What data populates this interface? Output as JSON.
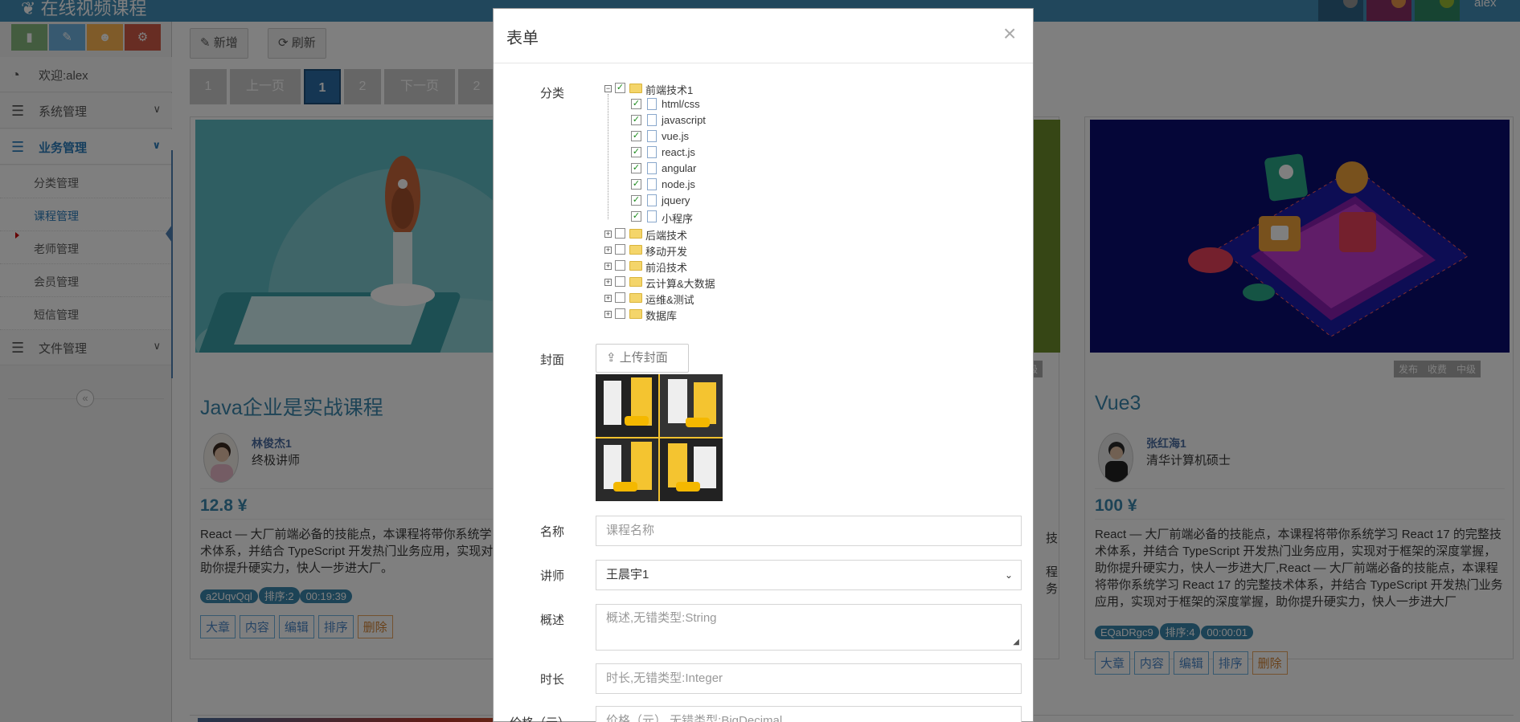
{
  "app": {
    "brand": "在线视频课程",
    "user": "alex"
  },
  "sidebar": {
    "welcome": "欢迎:alex",
    "menus": [
      {
        "label": "系统管理"
      },
      {
        "label": "业务管理"
      },
      {
        "label": "文件管理"
      }
    ],
    "items": [
      {
        "label": "分类管理"
      },
      {
        "label": "课程管理"
      },
      {
        "label": "老师管理"
      },
      {
        "label": "会员管理"
      },
      {
        "label": "短信管理"
      }
    ]
  },
  "toolbar": {
    "add_label": "新增",
    "refresh_label": "刷新"
  },
  "pagination": [
    "1",
    "上一页",
    "1",
    "2",
    "下一页",
    "2"
  ],
  "cards": [
    {
      "title": "Java企业是实战课程",
      "teacher_name": "林俊杰1",
      "teacher_title": "终极讲师",
      "price": "12.8 ¥",
      "desc": "React — 大厂前端必备的技能点，本课程将带你系统学习 React 17 的完整技术体系，并结合 TypeScript 开发热门业务应用，实现对于框架的深度掌握，助你提升硬实力，快人一步进大厂。",
      "badges": [
        "a2UqvQql",
        "排序:2",
        "00:19:39"
      ],
      "actions": [
        "大章",
        "内容",
        "编辑",
        "排序",
        "删除"
      ]
    },
    {
      "tag": "级",
      "desc_frag": [
        "技",
        "程",
        "务"
      ]
    },
    {
      "title": "Vue3",
      "teacher_name": "张红海1",
      "teacher_title": "清华计算机硕士",
      "price": "100 ¥",
      "desc": "React — 大厂前端必备的技能点，本课程将带你系统学习 React 17 的完整技术体系，并结合 TypeScript 开发热门业务应用，实现对于框架的深度掌握，助你提升硬实力，快人一步进大厂,React — 大厂前端必备的技能点，本课程将带你系统学习 React 17 的完整技术体系，并结合 TypeScript 开发热门业务应用，实现对于框架的深度掌握，助你提升硬实力，快人一步进大厂",
      "badges": [
        "EQaDRgc9",
        "排序:4",
        "00:00:01"
      ],
      "tags": [
        "发布",
        "收费",
        "中级"
      ],
      "actions": [
        "大章",
        "内容",
        "编辑",
        "排序",
        "删除"
      ]
    }
  ],
  "modal": {
    "title": "表单",
    "close": "×",
    "labels": {
      "category": "分类",
      "cover": "封面",
      "name": "名称",
      "teacher": "讲师",
      "summary": "概述",
      "duration": "时长",
      "price": "价格（元）"
    },
    "tree": {
      "root": "前端技术1",
      "children": [
        "html/css",
        "javascript",
        "vue.js",
        "react.js",
        "angular",
        "node.js",
        "jquery",
        "小程序"
      ],
      "others": [
        "后端技术",
        "移动开发",
        "前沿技术",
        "云计算&大数据",
        "运维&测试",
        "数据库"
      ]
    },
    "upload_label": "上传封面",
    "name_placeholder": "课程名称",
    "teacher_value": "王晨宇1",
    "summary_placeholder": "概述,无错类型:String",
    "duration_placeholder": "时长,无错类型:Integer",
    "price_placeholder": "价格（元）,无错类型:BigDecimal"
  },
  "colors": {
    "topbar": "#438eb9",
    "accent": "#3a87ad",
    "shortcut_colors": [
      "#87b87f",
      "#6fb3e0",
      "#ffb752",
      "#d15b47"
    ]
  }
}
